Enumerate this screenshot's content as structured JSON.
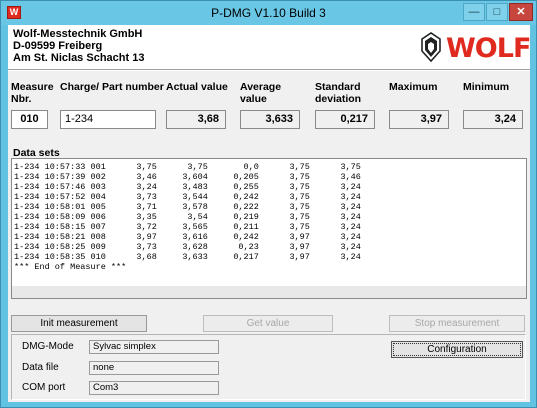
{
  "window": {
    "title": "P-DMG V1.10 Build 3",
    "icon_letter": "W",
    "minimize_glyph": "—",
    "maximize_glyph": "□",
    "close_glyph": "✕"
  },
  "company": {
    "name": "Wolf-Messtechnik GmbH",
    "city": "D-09599 Freiberg",
    "street": "Am St. Niclas Schacht 13",
    "logo_text": "WOLF",
    "logo_color": "#e02a1f"
  },
  "columns": {
    "measure_nbr": "Measure Nbr.",
    "charge_part": "Charge/ Part number",
    "actual": "Actual value",
    "average": "Average value",
    "stddev": "Standard deviation",
    "maximum": "Maximum",
    "minimum": "Minimum"
  },
  "values": {
    "measure_nbr": "010",
    "charge_part": "1-234",
    "actual": "3,68",
    "average": "3,633",
    "stddev": "0,217",
    "maximum": "3,97",
    "minimum": "3,24"
  },
  "datasets": {
    "label": "Data sets",
    "lines": [
      "1-234 10:57:33 001      3,75      3,75       0,0      3,75      3,75",
      "1-234 10:57:39 002      3,46     3,604     0,205      3,75      3,46",
      "1-234 10:57:46 003      3,24     3,483     0,255      3,75      3,24",
      "1-234 10:57:52 004      3,73     3,544     0,242      3,75      3,24",
      "1-234 10:58:01 005      3,71     3,578     0,222      3,75      3,24",
      "1-234 10:58:09 006      3,35      3,54     0,219      3,75      3,24",
      "1-234 10:58:15 007      3,72     3,565     0,211      3,75      3,24",
      "1-234 10:58:21 008      3,97     3,616     0,242      3,97      3,24",
      "1-234 10:58:25 009      3,73     3,628      0,23      3,97      3,24",
      "1-234 10:58:35 010      3,68     3,633     0,217      3,97      3,24",
      "*** End of Measure ***"
    ]
  },
  "buttons": {
    "init": "Init measurement",
    "get_value": "Get value",
    "stop": "Stop measurement",
    "configuration": "Configuration"
  },
  "settings": {
    "dmg_mode_label": "DMG-Mode",
    "dmg_mode_value": "Sylvac simplex",
    "data_file_label": "Data file",
    "data_file_value": "none",
    "com_port_label": "COM port",
    "com_port_value": "Com3"
  }
}
